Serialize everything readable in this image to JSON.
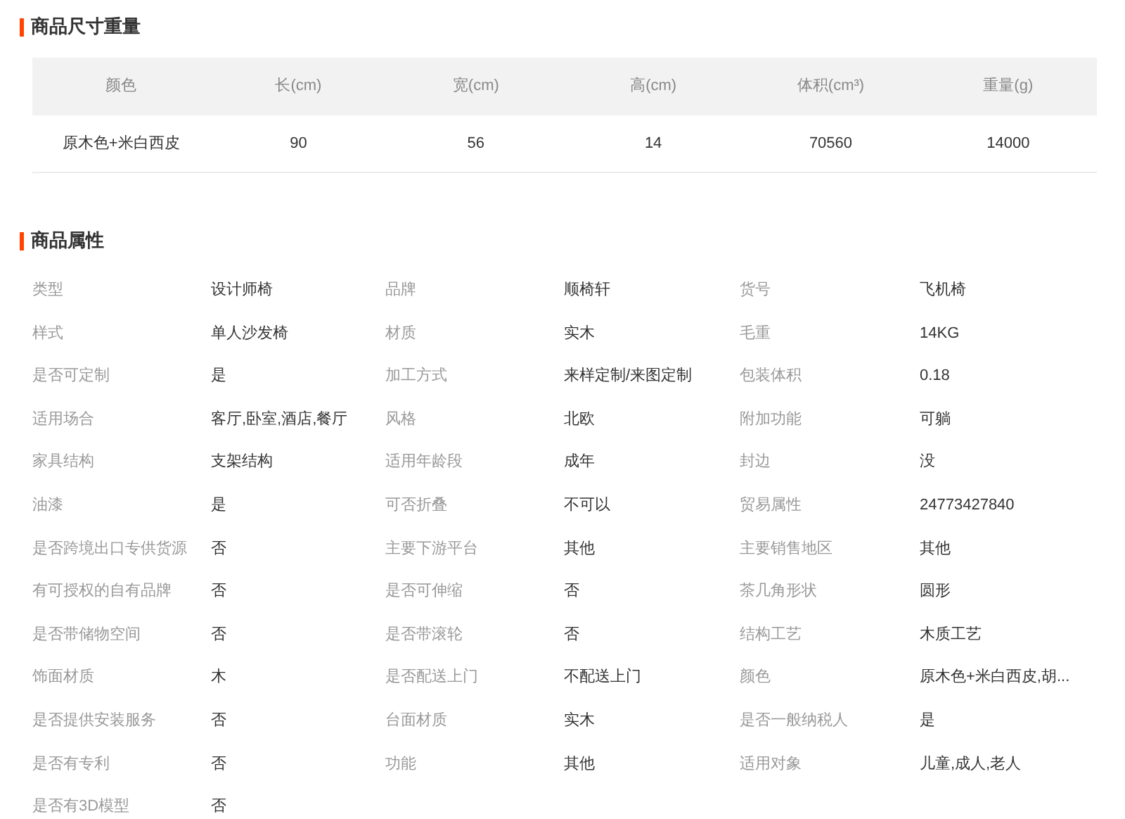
{
  "size_section": {
    "title": "商品尺寸重量",
    "columns": [
      "颜色",
      "长(cm)",
      "宽(cm)",
      "高(cm)",
      "体积(cm³)",
      "重量(g)"
    ],
    "rows": [
      [
        "原木色+米白西皮",
        "90",
        "56",
        "14",
        "70560",
        "14000"
      ]
    ]
  },
  "attributes_section": {
    "title": "商品属性",
    "attributes": [
      {
        "label": "类型",
        "value": "设计师椅"
      },
      {
        "label": "品牌",
        "value": "顺椅轩"
      },
      {
        "label": "货号",
        "value": "飞机椅"
      },
      {
        "label": "样式",
        "value": "单人沙发椅"
      },
      {
        "label": "材质",
        "value": "实木"
      },
      {
        "label": "毛重",
        "value": "14KG"
      },
      {
        "label": "是否可定制",
        "value": "是"
      },
      {
        "label": "加工方式",
        "value": "来样定制/来图定制"
      },
      {
        "label": "包装体积",
        "value": "0.18"
      },
      {
        "label": "适用场合",
        "value": "客厅,卧室,酒店,餐厅"
      },
      {
        "label": "风格",
        "value": "北欧"
      },
      {
        "label": "附加功能",
        "value": "可躺"
      },
      {
        "label": "家具结构",
        "value": "支架结构"
      },
      {
        "label": "适用年龄段",
        "value": "成年"
      },
      {
        "label": "封边",
        "value": "没"
      },
      {
        "label": "油漆",
        "value": "是"
      },
      {
        "label": "可否折叠",
        "value": "不可以"
      },
      {
        "label": "贸易属性",
        "value": "24773427840"
      },
      {
        "label": "是否跨境出口专供货源",
        "value": "否"
      },
      {
        "label": "主要下游平台",
        "value": "其他"
      },
      {
        "label": "主要销售地区",
        "value": "其他"
      },
      {
        "label": "有可授权的自有品牌",
        "value": "否"
      },
      {
        "label": "是否可伸缩",
        "value": "否"
      },
      {
        "label": "茶几角形状",
        "value": "圆形"
      },
      {
        "label": "是否带储物空间",
        "value": "否"
      },
      {
        "label": "是否带滚轮",
        "value": "否"
      },
      {
        "label": "结构工艺",
        "value": "木质工艺"
      },
      {
        "label": "饰面材质",
        "value": "木"
      },
      {
        "label": "是否配送上门",
        "value": "不配送上门"
      },
      {
        "label": "颜色",
        "value": "原木色+米白西皮,胡..."
      },
      {
        "label": "是否提供安装服务",
        "value": "否"
      },
      {
        "label": "台面材质",
        "value": "实木"
      },
      {
        "label": "是否一般纳税人",
        "value": "是"
      },
      {
        "label": "是否有专利",
        "value": "否"
      },
      {
        "label": "功能",
        "value": "其他"
      },
      {
        "label": "适用对象",
        "value": "儿童,成人,老人"
      },
      {
        "label": "是否有3D模型",
        "value": "否"
      }
    ]
  }
}
